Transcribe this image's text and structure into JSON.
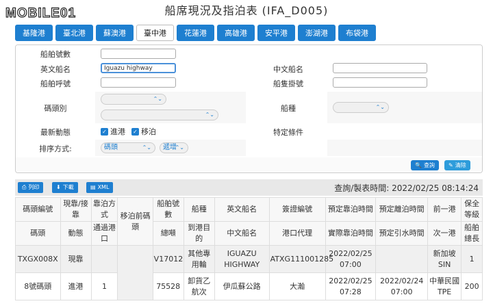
{
  "header": {
    "logo_text": "MOBILE01",
    "title": "船席現況及指泊表 (IFA_D005)"
  },
  "ports": [
    {
      "label": "基隆港",
      "active": false
    },
    {
      "label": "臺北港",
      "active": false
    },
    {
      "label": "蘇澳港",
      "active": false
    },
    {
      "label": "臺中港",
      "active": true
    },
    {
      "label": "花蓮港",
      "active": false
    },
    {
      "label": "高雄港",
      "active": false
    },
    {
      "label": "安平港",
      "active": false
    },
    {
      "label": "澎湖港",
      "active": false
    },
    {
      "label": "布袋港",
      "active": false
    }
  ],
  "search": {
    "ship_number_label": "船舶號數",
    "ship_number_value": "",
    "english_name_label": "英文船名",
    "english_name_value": "Iguazu highway",
    "chinese_name_label": "中文船名",
    "chinese_name_value": "",
    "callsign_label": "船舶呼號",
    "callsign_value": "",
    "flag_label": "船隻掛號",
    "flag_value": "",
    "pier_label": "碼頭別",
    "pier_select1": "",
    "pier_select2": "",
    "ship_type_label": "船種",
    "ship_type_value": "",
    "latest_label": "最新動態",
    "latest_in": "進港",
    "latest_move": "移泊",
    "special_label": "特定條件",
    "sort_label": "排序方式:",
    "sort_field": "碼頭",
    "sort_order": "遞增",
    "query_button": "查詢",
    "clear_button": "清除"
  },
  "results": {
    "print_button": "列印",
    "download_button": "下載",
    "xml_button": "XML",
    "query_time": "查詢/製表時間: 2022/02/25 08:14:24",
    "header_row1": [
      "碼頭編號",
      "現靠/接靠",
      "靠泊方式",
      "移泊前碼頭",
      "船舶號數",
      "船種",
      "英文船名",
      "簽證編號",
      "預定靠泊時間",
      "預定離泊時間",
      "前一港",
      "保全等級"
    ],
    "header_row2": [
      "碼頭",
      "動態",
      "通過港口",
      "總噸",
      "到港目的",
      "中文船名",
      "港口代理",
      "實際靠泊時間",
      "預定引水時間",
      "次一港",
      "船舶總長"
    ],
    "rows": [
      {
        "top": [
          "TXGX008X",
          "現靠",
          "",
          "",
          "V17012",
          "其他專用輪",
          "IGUAZU HIGHWAY",
          "ATXG111001285",
          "2022/02/25 07:00",
          "",
          "新加坡 SIN",
          "1"
        ]
      },
      {
        "top": [
          "8號碼頭",
          "進港",
          "1",
          "",
          "75528",
          "卸貨乙航次",
          "伊瓜蘇公路",
          "大瀚",
          "2022/02/25 07:28",
          "2022/02/24 07:00",
          "中華民國 TPE",
          "200"
        ]
      }
    ]
  },
  "colors": {
    "accent": "#1e7fd0",
    "clear_button": "#2d9cdb"
  }
}
